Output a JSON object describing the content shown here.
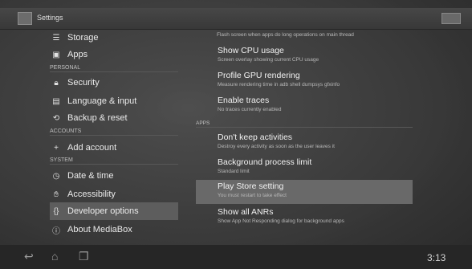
{
  "actionbar": {
    "title": "Settings",
    "app_icon": "settings-icon",
    "overflow_icon": "overflow-menu-icon"
  },
  "left": {
    "storage": {
      "label": "Storage",
      "icon": "storage-icon"
    },
    "apps": {
      "label": "Apps",
      "icon": "apps-icon"
    },
    "header_personal": "PERSONAL",
    "security": {
      "label": "Security",
      "icon": "lock-icon"
    },
    "language": {
      "label": "Language & input",
      "icon": "language-icon"
    },
    "backup": {
      "label": "Backup & reset",
      "icon": "backup-icon"
    },
    "header_accounts": "ACCOUNTS",
    "add_account": {
      "label": "Add account",
      "icon": "plus-icon"
    },
    "header_system": "SYSTEM",
    "datetime": {
      "label": "Date & time",
      "icon": "clock-icon"
    },
    "accessibility": {
      "label": "Accessibility",
      "icon": "hand-icon"
    },
    "developer": {
      "label": "Developer options",
      "icon": "braces-icon",
      "selected": true
    },
    "about": {
      "label": "About MediaBox",
      "icon": "info-icon"
    }
  },
  "right": {
    "top_note": "Flash screen when apps do long operations on main thread",
    "show_cpu": {
      "title": "Show CPU usage",
      "summary": "Screen overlay showing current CPU usage"
    },
    "profile_gpu": {
      "title": "Profile GPU rendering",
      "summary": "Measure rendering time in adb shell dumpsys gfxinfo"
    },
    "enable_traces": {
      "title": "Enable traces",
      "summary": "No traces currently enabled"
    },
    "header_apps": "APPS",
    "dont_keep": {
      "title": "Don't keep activities",
      "summary": "Destroy every activity as soon as the user leaves it"
    },
    "bg_limit": {
      "title": "Background process limit",
      "summary": "Standard limit"
    },
    "play_store": {
      "title": "Play Store setting",
      "summary": "You must restart to take effect"
    },
    "show_anrs": {
      "title": "Show all ANRs",
      "summary": "Show App Not Responding dialog for background apps"
    }
  },
  "navbar": {
    "back_icon": "back-icon",
    "home_icon": "home-icon",
    "recents_icon": "recents-icon",
    "clock": "3:13"
  }
}
